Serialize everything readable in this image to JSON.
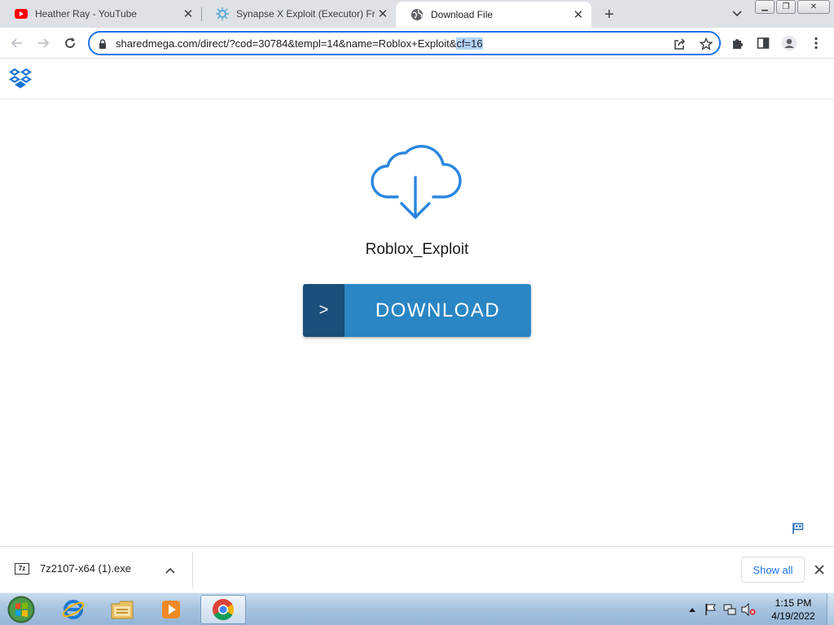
{
  "browser": {
    "tabs": [
      {
        "title": "Heather Ray - YouTube",
        "favicon": "youtube-icon"
      },
      {
        "title": "Synapse X Exploit (Executor) Free",
        "favicon": "synapse-icon"
      },
      {
        "title": "Download File",
        "favicon": "globe-icon",
        "active": true
      }
    ],
    "url_main": "sharedmega.com/direct/?cod=30784&templ=14&name=Roblox+Exploit&",
    "url_selected": "cf=16"
  },
  "page": {
    "filename": "Roblox_Exploit",
    "download_arrow": ">",
    "download_label": "DOWNLOAD"
  },
  "download_shelf": {
    "file_name": "7z2107-x64 (1).exe",
    "file_icon_text": "7z",
    "show_all_label": "Show all"
  },
  "taskbar": {
    "time": "1:15 PM",
    "date": "4/19/2022"
  },
  "colors": {
    "accent": "#1a73e8",
    "download_button": "#2a86c4",
    "download_arrow_bg": "#1b4e7a",
    "cloud_icon": "#2a86e0"
  }
}
